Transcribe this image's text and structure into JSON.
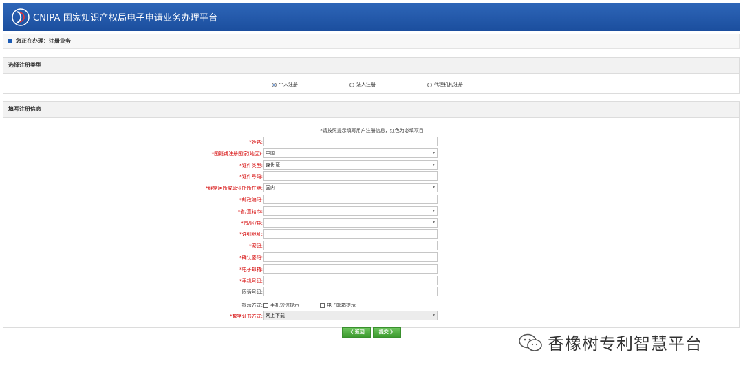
{
  "header": {
    "title": "CNIPA 国家知识产权局电子申请业务办理平台"
  },
  "status": {
    "text": "您正在办理：注册业务"
  },
  "type_section": {
    "title": "选择注册类型",
    "options": [
      {
        "label": "个人注册",
        "checked": true
      },
      {
        "label": "法人注册",
        "checked": false
      },
      {
        "label": "代理机构注册",
        "checked": false
      }
    ]
  },
  "info_section": {
    "title": "填写注册信息",
    "note": "*请按照提示填写用户注册信息，红色为必填项目",
    "fields": [
      {
        "label": "*姓名:",
        "value": "",
        "type": "text"
      },
      {
        "label": "*国籍或注册国家(地区):",
        "value": "中国",
        "type": "select"
      },
      {
        "label": "*证件类型:",
        "value": "身份证",
        "type": "select"
      },
      {
        "label": "*证件号码:",
        "value": "",
        "type": "text"
      },
      {
        "label": "*经常居所或营业所所在地:",
        "value": "国内",
        "type": "select"
      },
      {
        "label": "*邮政编码:",
        "value": "",
        "type": "text"
      },
      {
        "label": "*省/直辖市:",
        "value": "",
        "type": "select"
      },
      {
        "label": "*市/区/县:",
        "value": "",
        "type": "select"
      },
      {
        "label": "*详细地址:",
        "value": "",
        "type": "text"
      },
      {
        "label": "*密码:",
        "value": "",
        "type": "text"
      },
      {
        "label": "*确认密码:",
        "value": "",
        "type": "text"
      },
      {
        "label": "*电子邮箱:",
        "value": "",
        "type": "text"
      },
      {
        "label": "*手机号码:",
        "value": "",
        "type": "text"
      },
      {
        "label": "固话号码:",
        "value": "",
        "type": "text"
      }
    ],
    "notify": {
      "label": "提示方式:",
      "options": [
        "手机短信提示",
        "电子邮箱提示"
      ]
    },
    "cert": {
      "label": "*数字证书方式:",
      "value": "网上下载"
    }
  },
  "buttons": {
    "back": "《 返回",
    "submit": "提交 》"
  },
  "watermark": {
    "text": "香橡树专利智慧平台"
  },
  "colors": {
    "header_bg": "#1b4e9e",
    "required": "#d40000",
    "button": "#4aa83b"
  }
}
